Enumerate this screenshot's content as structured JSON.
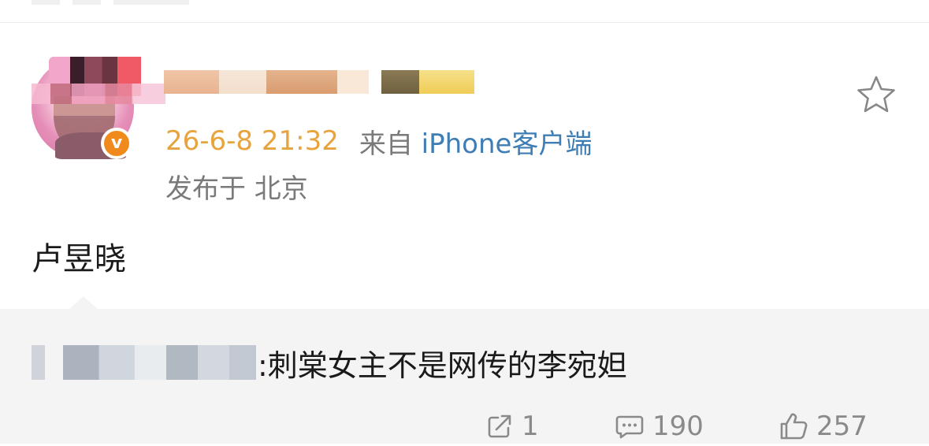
{
  "post": {
    "time": "26-6-8 21:32",
    "source_prefix": "来自 ",
    "source_device": "iPhone客户端",
    "location": "发布于 北京",
    "text": "卢昱晓"
  },
  "quote": {
    "text": ":刺棠女主不是网传的李宛妲"
  },
  "stats": {
    "reposts": "1",
    "comments": "190",
    "likes": "257"
  },
  "colors": {
    "time": "#e8a33d",
    "device_link": "#3f7db5",
    "verified_badge": "#f08a1c",
    "quote_background": "#f4f4f4"
  },
  "icons": {
    "verified": "verified-badge-icon",
    "favorite": "star-icon",
    "repost": "repost-icon",
    "comment": "comment-icon",
    "like": "thumbs-up-icon"
  }
}
